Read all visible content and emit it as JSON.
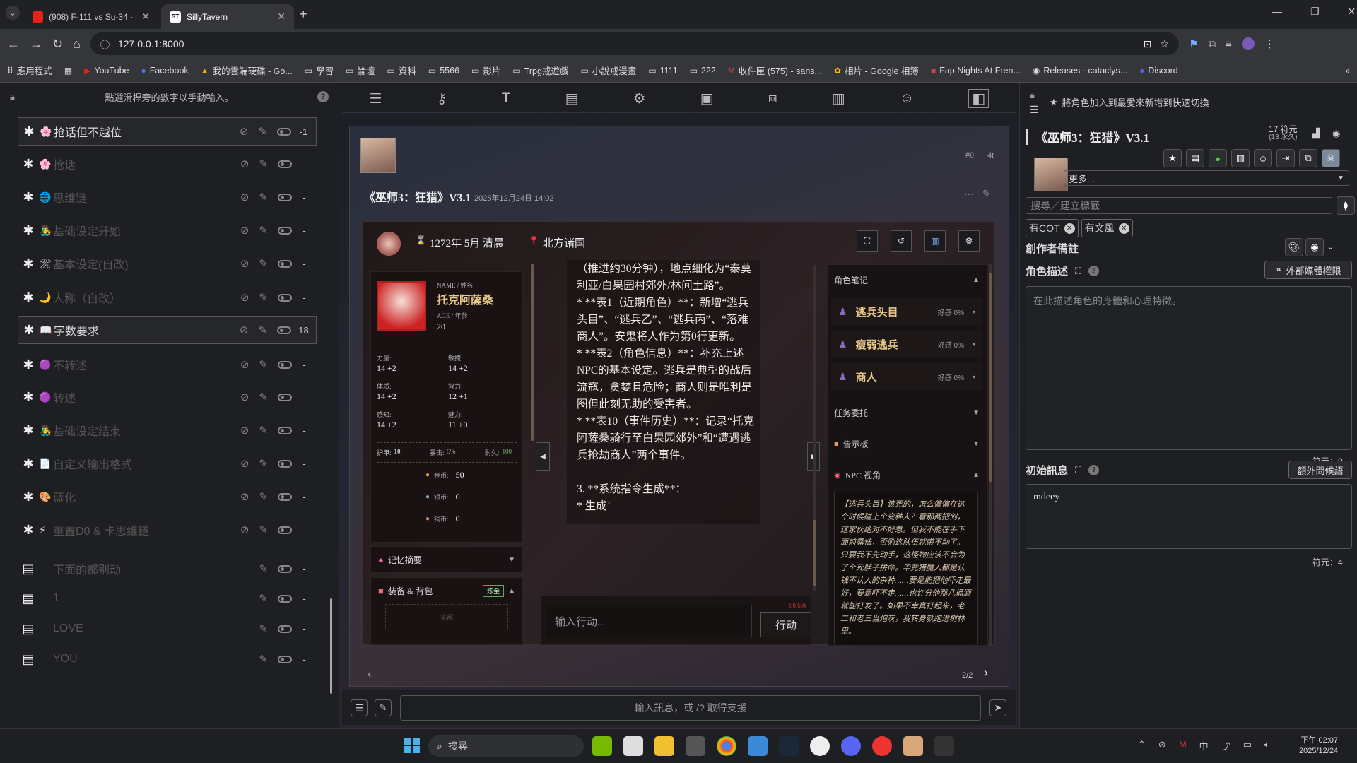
{
  "browser": {
    "tabs": [
      {
        "title": "(908) F-111 vs Su-34 - Cockpi",
        "active": false
      },
      {
        "title": "SillyTavern",
        "active": true
      }
    ],
    "url": "127.0.0.1:8000",
    "bookmarks": [
      "應用程式",
      "YouTube",
      "Facebook",
      "我的雲端硬碟 - Go...",
      "學習",
      "論壇",
      "資料",
      "5566",
      "影片",
      "Trpg戒遊戲",
      "小說戒漫畫",
      "1111",
      "222",
      "收件匣 (575) - sans...",
      "相片 - Google 相簿",
      "Fap Nights At Fren...",
      "Releases · cataclys...",
      "Discord"
    ]
  },
  "left_panel": {
    "hint": "點選滑桿旁的數字以手動輸入。",
    "help": "?",
    "entries": [
      {
        "label": "抢话但不越位",
        "emoji": "🌸",
        "num": "-1",
        "selected": true,
        "dim": false
      },
      {
        "label": "抢话",
        "emoji": "🌸",
        "num": "-",
        "selected": false,
        "dim": true
      },
      {
        "label": "思维链",
        "emoji": "🌐",
        "num": "-",
        "selected": false,
        "dim": true
      },
      {
        "label": "基础设定开始",
        "emoji": "👨‍🎤",
        "num": "-",
        "selected": false,
        "dim": true
      },
      {
        "label": "基本设定(自改)",
        "emoji": "🛠",
        "num": "-",
        "selected": false,
        "dim": true
      },
      {
        "label": "人称（自改）",
        "emoji": "🌙",
        "num": "-",
        "selected": false,
        "dim": true
      },
      {
        "label": "字数要求",
        "emoji": "📖",
        "num": "18",
        "selected": true,
        "dim": false
      },
      {
        "label": "不转述",
        "emoji": "🟣",
        "num": "-",
        "selected": false,
        "dim": true
      },
      {
        "label": "转述",
        "emoji": "🟣",
        "num": "-",
        "selected": false,
        "dim": true
      },
      {
        "label": "基础设定结束",
        "emoji": "👨‍🎤",
        "num": "-",
        "selected": false,
        "dim": true
      },
      {
        "label": "自定义输出格式",
        "emoji": "📄",
        "num": "-",
        "selected": false,
        "dim": true
      },
      {
        "label": "蓝化",
        "emoji": "🎨",
        "num": "-",
        "selected": false,
        "dim": true
      },
      {
        "label": "重置D0 & 卡思维链",
        "emoji": "⚡",
        "num": "-",
        "selected": false,
        "dim": true
      },
      {
        "label": "下面的都别动",
        "emoji": "",
        "num": "-",
        "selected": false,
        "dim": true
      },
      {
        "label": "1",
        "emoji": "",
        "num": "-",
        "selected": false,
        "dim": true
      },
      {
        "label": "LOVE",
        "emoji": "",
        "num": "-",
        "selected": false,
        "dim": true
      },
      {
        "label": "YOU",
        "emoji": "",
        "num": "-",
        "selected": false,
        "dim": true
      }
    ]
  },
  "chat": {
    "title": "《巫师3：狂猎》V3.1",
    "timestamp": "2025年12月24日 14:02",
    "msg_id": "#0",
    "tokens": "4t",
    "game": {
      "time": "1272年 5月 清晨",
      "location": "北方诸国",
      "name_label": "NAME / 姓名",
      "name": "托克阿薩桑",
      "age_label": "AGE / 年龄",
      "age": "20",
      "stats": [
        {
          "k": "力量:",
          "v": "14 +2"
        },
        {
          "k": "敏捷:",
          "v": "14 +2"
        },
        {
          "k": "体质:",
          "v": "14 +2"
        },
        {
          "k": "智力:",
          "v": "12 +1"
        },
        {
          "k": "感知:",
          "v": "14 +2"
        },
        {
          "k": "魅力:",
          "v": "11 +0"
        }
      ],
      "armor_label": "护甲:",
      "armor": "10",
      "crit_label": "暴击:",
      "crit": "5%",
      "dur_label": "耐久:",
      "dur": "100",
      "coins": [
        {
          "k": "金币:",
          "v": "50"
        },
        {
          "k": "银币:",
          "v": "0"
        },
        {
          "k": "铜币:",
          "v": "0"
        }
      ],
      "memory_label": "记忆摘要",
      "equip_label": "装备 & 背包",
      "alchemy_label": "炼金",
      "head_slot": "头部",
      "story": "（推进约30分钟），地点细化为“泰莫利亚/白果园村郊外/林间土路”。\n* **表1（近期角色）**：新增“逃兵头目”、“逃兵乙”、“逃兵丙”、“落难商人”。安鬼将人作为第0行更新。\n* **表2（角色信息）**：补充上述NPC的基本设定。逃兵是典型的战后流寇，贪婪且危险；商人则是唯利是图但此刻无助的受害者。\n* **表10（事件历史）**：记录“托克阿薩桑骑行至白果园郊外”和“遭遇逃兵抢劫商人”两个事件。\n\n3. **系统指令生成**：\n* 生成`",
      "input_placeholder": "输入行动...",
      "action_btn": "行动",
      "timer": "80.69s",
      "notes_label": "角色笔记",
      "npcs": [
        {
          "name": "逃兵头目",
          "aff": "好感 0%"
        },
        {
          "name": "瘦弱逃兵",
          "aff": "好感 0%"
        },
        {
          "name": "商人",
          "aff": "好感 0%"
        }
      ],
      "quest_label": "任务委托",
      "board_label": "告示板",
      "npc_view_label": "NPC 视角",
      "npc_view_text": "【逃兵头目】该死的，怎么偏偏在这个时候碰上个变种人？看那两把剑，这家伙绝对不好惹。但我不能在手下面前露怯，否则这队伍就带不动了。只要我不先动手，这怪物应该不会为了个死胖子拼命。毕竟猎魔人都是认钱不认人的杂种……要是能把他吓走最好，要是吓不走……也许分他那几桶酒就能打发了。如果不幸真打起来，老二和老三当炮灰，我转身就跑进树林里。"
    },
    "pager": "2/2",
    "send_placeholder": "輸入訊息，或 /? 取得支援"
  },
  "right_panel": {
    "fav_hint": "將角色加入到最愛來新增到快速切換",
    "char_name": "《巫师3：狂猎》V3.1",
    "tokens": "17 符元",
    "tokens_perm": "(13 永久)",
    "more": "更多...",
    "tag_placeholder": "搜尋／建立標籤",
    "tags": [
      "有COT",
      "有文風"
    ],
    "creator_notes": "創作者備註",
    "desc_label": "角色描述",
    "ext_media": "外部媒體權限",
    "desc_placeholder": "在此描述角色的身體和心理特徵。",
    "desc_tokens": "符元：0",
    "first_msg_label": "初始訊息",
    "alt_greet": "額外問候語",
    "first_msg": "mdeey",
    "first_tokens": "符元：4"
  },
  "taskbar": {
    "search": "搜尋",
    "ime": "中",
    "time": "下午 02:07",
    "date": "2025/12/24"
  },
  "colors": {
    "accent": "#c9a86a",
    "npc_name": "#e8c888",
    "purple": "#8a6bb8"
  }
}
